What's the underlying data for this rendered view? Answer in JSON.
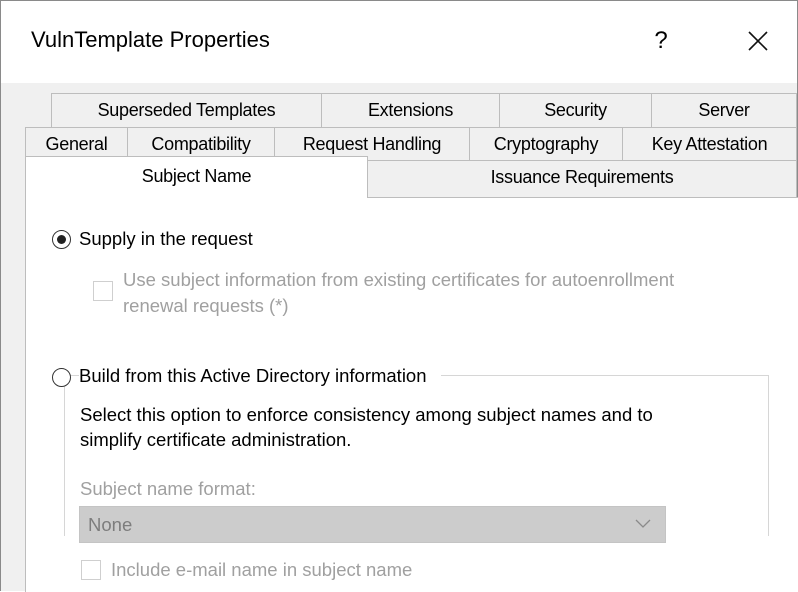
{
  "window": {
    "title": "VulnTemplate Properties",
    "help_label": "?"
  },
  "tabs": {
    "row1": [
      "Superseded Templates",
      "Extensions",
      "Security",
      "Server"
    ],
    "row2": [
      "General",
      "Compatibility",
      "Request Handling",
      "Cryptography",
      "Key Attestation"
    ],
    "row3": [
      "Subject Name",
      "Issuance Requirements"
    ],
    "active": "Subject Name"
  },
  "subject_name": {
    "supply_option": {
      "label": "Supply in the request",
      "selected": true
    },
    "autoenroll_checkbox": {
      "line1": "Use subject information from existing certificates for autoenrollment",
      "line2": "renewal requests (*)",
      "checked": false,
      "enabled": false
    },
    "build_option": {
      "label": "Build from this Active Directory information",
      "selected": false
    },
    "description": {
      "line1": "Select this option to enforce consistency among subject names and to",
      "line2": "simplify certificate administration."
    },
    "format_label": "Subject name format:",
    "format_value": "None",
    "email_checkbox": {
      "label": "Include e-mail name in subject name",
      "checked": false,
      "enabled": false
    }
  }
}
